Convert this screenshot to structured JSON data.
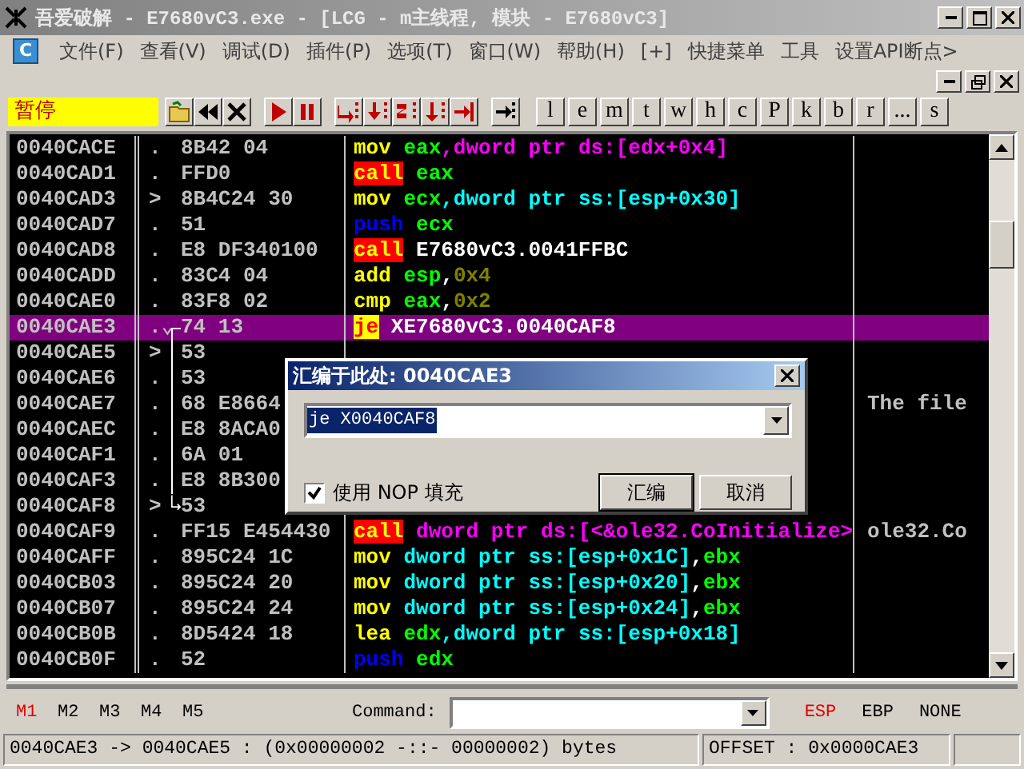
{
  "window": {
    "title": "吾爱破解 - E7680vC3.exe - [LCG - m主线程, 模块 - E7680vC3]"
  },
  "menu": [
    {
      "kind": "logo",
      "label": "C"
    },
    {
      "kind": "item",
      "label": "文件(F)"
    },
    {
      "kind": "item",
      "label": "查看(V)"
    },
    {
      "kind": "item",
      "label": "调试(D)"
    },
    {
      "kind": "item",
      "label": "插件(P)"
    },
    {
      "kind": "item",
      "label": "选项(T)"
    },
    {
      "kind": "item",
      "label": "窗口(W)"
    },
    {
      "kind": "item",
      "label": "帮助(H)"
    },
    {
      "kind": "item",
      "label": "[+]"
    },
    {
      "kind": "item",
      "label": "快捷菜单"
    },
    {
      "kind": "item",
      "label": "工具"
    },
    {
      "kind": "item",
      "label": "设置API断点>"
    }
  ],
  "toolbar": {
    "status": "暂停",
    "buttons": [
      {
        "kind": "open"
      },
      {
        "kind": "rewind"
      },
      {
        "kind": "close"
      },
      {
        "kind": "gap"
      },
      {
        "kind": "run"
      },
      {
        "kind": "pause"
      },
      {
        "kind": "gap"
      },
      {
        "kind": "step-in"
      },
      {
        "kind": "step-over"
      },
      {
        "kind": "trace-in"
      },
      {
        "kind": "trace-over"
      },
      {
        "kind": "return"
      },
      {
        "kind": "gap"
      },
      {
        "kind": "goto"
      },
      {
        "kind": "gap"
      }
    ],
    "letters": [
      "l",
      "e",
      "m",
      "t",
      "w",
      "h",
      "c",
      "P",
      "k",
      "b",
      "r",
      "...",
      "s"
    ]
  },
  "listing": {
    "rows": [
      {
        "address": "0040CACE",
        "marker": ".",
        "hex": "8B42 04",
        "kind": "plain",
        "selected": false,
        "disasm": [
          {
            "text": "mov ",
            "color": "#ffff00"
          },
          {
            "text": "eax",
            "color": "#00ff00"
          },
          {
            "text": ",dword ptr ds:[edx+0x4]",
            "color": "#ff00ff"
          }
        ]
      },
      {
        "address": "0040CAD1",
        "marker": ".",
        "hex": "FFD0",
        "kind": "plain",
        "selected": false,
        "disasm": [
          {
            "text": "call",
            "kind": "call"
          },
          {
            "text": " eax",
            "color": "#00ff00"
          }
        ]
      },
      {
        "address": "0040CAD3",
        "marker": ">",
        "hex": "8B4C24 30",
        "kind": "plain",
        "selected": false,
        "disasm": [
          {
            "text": "mov ",
            "color": "#ffff00"
          },
          {
            "text": "ecx",
            "color": "#00ff00"
          },
          {
            "text": ",dword ptr ss:[esp+0x30]",
            "color": "#00ffff"
          }
        ]
      },
      {
        "address": "0040CAD7",
        "marker": ".",
        "hex": "51",
        "kind": "plain",
        "selected": false,
        "disasm": [
          {
            "text": "push ",
            "color": "#0000ff"
          },
          {
            "text": "ecx",
            "color": "#00ff00"
          }
        ]
      },
      {
        "address": "0040CAD8",
        "marker": ".",
        "hex": "E8 DF340100",
        "kind": "plain",
        "selected": false,
        "disasm": [
          {
            "text": "call",
            "kind": "call"
          },
          {
            "text": " E7680vC3.0041FFBC",
            "color": "#ffffff"
          }
        ]
      },
      {
        "address": "0040CADD",
        "marker": ".",
        "hex": "83C4 04",
        "kind": "plain",
        "selected": false,
        "disasm": [
          {
            "text": "add ",
            "color": "#ffff00"
          },
          {
            "text": "esp",
            "color": "#00ff00"
          },
          {
            "text": ",",
            "color": "#ffffff"
          },
          {
            "text": "0x4",
            "color": "#808000"
          }
        ]
      },
      {
        "address": "0040CAE0",
        "marker": ".",
        "hex": "83F8 02",
        "kind": "plain",
        "selected": false,
        "disasm": [
          {
            "text": "cmp ",
            "color": "#ffff00"
          },
          {
            "text": "eax",
            "color": "#00ff00"
          },
          {
            "text": ",",
            "color": "#ffffff"
          },
          {
            "text": "0x2",
            "color": "#808000"
          }
        ]
      },
      {
        "address": "0040CAE3",
        "marker": ".⌄",
        "hex": "74 13",
        "kind": "start",
        "selected": true,
        "disasm": [
          {
            "text": "je",
            "kind": "jump"
          },
          {
            "text": " XE7680vC3.0040CAF8"
          }
        ]
      },
      {
        "address": "0040CAE5",
        "marker": ">",
        "hex": "53",
        "kind": "mid",
        "selected": false,
        "disasm": []
      },
      {
        "address": "0040CAE6",
        "marker": ".",
        "hex": "53",
        "kind": "mid",
        "selected": false,
        "disasm": []
      },
      {
        "address": "0040CAE7",
        "marker": ".",
        "hex": "68 E8664",
        "kind": "mid",
        "selected": false,
        "disasm": [],
        "comment": "The file"
      },
      {
        "address": "0040CAEC",
        "marker": ".",
        "hex": "E8 8ACA0",
        "kind": "mid",
        "selected": false,
        "disasm": []
      },
      {
        "address": "0040CAF1",
        "marker": ".",
        "hex": "6A 01",
        "kind": "mid",
        "selected": false,
        "disasm": []
      },
      {
        "address": "0040CAF3",
        "marker": ".",
        "hex": "E8 8B300",
        "kind": "mid",
        "selected": false,
        "disasm": []
      },
      {
        "address": "0040CAF8",
        "marker": ">",
        "hex": "53",
        "kind": "end",
        "selected": false,
        "disasm": []
      },
      {
        "address": "0040CAF9",
        "marker": ".",
        "hex": "FF15 E454430",
        "kind": "plain",
        "selected": false,
        "disasm": [
          {
            "text": "call",
            "kind": "call"
          },
          {
            "text": " dword ptr ds:[<&ole32.CoInitialize>",
            "color": "#ff00ff"
          }
        ],
        "comment": "ole32.Co"
      },
      {
        "address": "0040CAFF",
        "marker": ".",
        "hex": "895C24 1C",
        "kind": "plain",
        "selected": false,
        "disasm": [
          {
            "text": "mov ",
            "color": "#ffff00"
          },
          {
            "text": "dword ptr ss:[esp+0x1C]",
            "color": "#00ffff"
          },
          {
            "text": ",",
            "color": "#ffffff"
          },
          {
            "text": "ebx",
            "color": "#00ff00"
          }
        ]
      },
      {
        "address": "0040CB03",
        "marker": ".",
        "hex": "895C24 20",
        "kind": "plain",
        "selected": false,
        "disasm": [
          {
            "text": "mov ",
            "color": "#ffff00"
          },
          {
            "text": "dword ptr ss:[esp+0x20]",
            "color": "#00ffff"
          },
          {
            "text": ",",
            "color": "#ffffff"
          },
          {
            "text": "ebx",
            "color": "#00ff00"
          }
        ]
      },
      {
        "address": "0040CB07",
        "marker": ".",
        "hex": "895C24 24",
        "kind": "plain",
        "selected": false,
        "disasm": [
          {
            "text": "mov ",
            "color": "#ffff00"
          },
          {
            "text": "dword ptr ss:[esp+0x24]",
            "color": "#00ffff"
          },
          {
            "text": ",",
            "color": "#ffffff"
          },
          {
            "text": "ebx",
            "color": "#00ff00"
          }
        ]
      },
      {
        "address": "0040CB0B",
        "marker": ".",
        "hex": "8D5424 18",
        "kind": "plain",
        "selected": false,
        "disasm": [
          {
            "text": "lea ",
            "color": "#ffff00"
          },
          {
            "text": "edx",
            "color": "#00ff00"
          },
          {
            "text": ",dword ptr ss:[esp+0x18]",
            "color": "#00ffff"
          }
        ]
      },
      {
        "address": "0040CB0F",
        "marker": ".",
        "hex": "52",
        "kind": "plain",
        "selected": false,
        "disasm": [
          {
            "text": "push ",
            "color": "#0000ff"
          },
          {
            "text": "edx",
            "color": "#00ff00"
          }
        ]
      }
    ]
  },
  "dialog": {
    "title": "汇编于此处: 0040CAE3",
    "value": "je X0040CAF8",
    "nop_fill": {
      "label": "使用 NOP 填充",
      "checked": true
    },
    "buttons": [
      "汇编",
      "取消"
    ]
  },
  "command_bar": {
    "marks": [
      {
        "label": "M1",
        "selected": true
      },
      {
        "label": "M2",
        "selected": false
      },
      {
        "label": "M3",
        "selected": false
      },
      {
        "label": "M4",
        "selected": false
      },
      {
        "label": "M5",
        "selected": false
      }
    ],
    "label": "Command:",
    "registers": [
      {
        "label": "ESP",
        "selected": true
      },
      {
        "label": "EBP",
        "selected": false
      },
      {
        "label": "NONE",
        "selected": false
      }
    ]
  },
  "status_bar": {
    "range": "0040CAE3 -> 0040CAE5 : (0x00000002 -::- 00000002) bytes",
    "offset": "OFFSET : 0x0000CAE3"
  }
}
